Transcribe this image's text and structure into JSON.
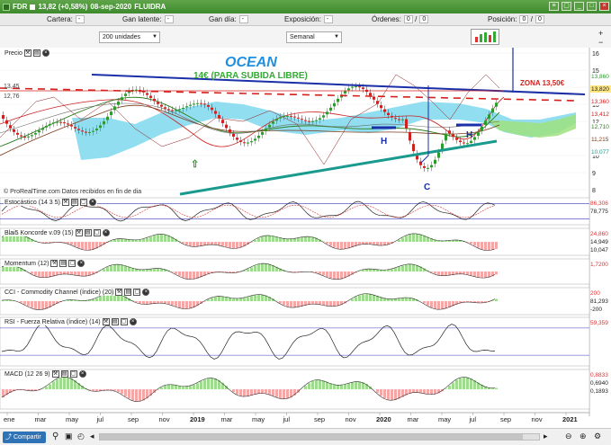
{
  "window": {
    "title_price": "13,82 (+0,58%)",
    "title_date": "08-sep-2020",
    "title_symbol": "FLUIDRA",
    "ticker": "FDR"
  },
  "infobar": {
    "cartera_label": "Cartera:",
    "cartera_value": "-",
    "ganlatente_label": "Gan latente:",
    "ganlatente_value": "-",
    "gandia_label": "Gan día:",
    "gandia_value": "-",
    "exposicion_label": "Exposición:",
    "exposicion_value": "-",
    "ordenes_label": "Órdenes:",
    "ordenes_value": "0",
    "ordenes_sep": "/",
    "ordenes_value2": "0",
    "posicion_label": "Posición:",
    "posicion_value": "0",
    "posicion_sep": "/",
    "posicion_value2": "0"
  },
  "toolbar": {
    "units_select": "200 unidades",
    "period_select": "Semanal"
  },
  "chart_annotations": {
    "title": "OCEAN",
    "subtitle": "14€ (PARA SUBIDA LIBRE)",
    "zone_label": "ZONA 13,50€",
    "h_left": "H",
    "h_right": "H",
    "c_label": "C",
    "left_level_1": "13,45",
    "left_level_2": "12,76",
    "source_note": "© ProRealTime.com Datos recibidos en fin de dia"
  },
  "price_panel": {
    "label": "Precio",
    "y_ticks": [
      "16",
      "15",
      "14",
      "13",
      "12",
      "11",
      "10",
      "9",
      "8"
    ],
    "right_values": [
      "13,860",
      "13,820",
      "13,360",
      "13,412",
      "12,710",
      "11,215",
      "10,077"
    ]
  },
  "indicators": [
    {
      "label": "Estocástico (14 3 5)",
      "values": [
        "86,306",
        "78,775"
      ]
    },
    {
      "label": "Blai5 Koncorde v.09 (15)",
      "values": [
        "24,860",
        "14,949",
        "10,047"
      ]
    },
    {
      "label": "Momentum (12)",
      "values": [
        "1,7200"
      ]
    },
    {
      "label": "CCI - Commodity Channel (índice) (20)",
      "values": [
        "200",
        "81,293",
        "-200"
      ]
    },
    {
      "label": "RSI - Fuerza Relativa (índice) (14)",
      "values": [
        "59,359"
      ]
    },
    {
      "label": "MACD (12 26 9)",
      "values": [
        "0,8833",
        "0,6940",
        "0,1893"
      ]
    }
  ],
  "x_axis": [
    "ene",
    "mar",
    "may",
    "jul",
    "sep",
    "nov",
    "2019",
    "mar",
    "may",
    "jul",
    "sep",
    "nov",
    "2020",
    "mar",
    "may",
    "jul",
    "sep",
    "nov",
    "2021"
  ],
  "footer": {
    "share_label": "Compartir"
  },
  "colors": {
    "titlebar": "#4a9636",
    "ichimoku": "#7fd8ef",
    "trend_blue": "#1a2fa8",
    "trend_teal": "#1a9a8e",
    "red_dashed": "#d3201c",
    "zone_text": "#d3201c",
    "title_text": "#1f8fe0",
    "subtitle_text": "#33aa33"
  }
}
